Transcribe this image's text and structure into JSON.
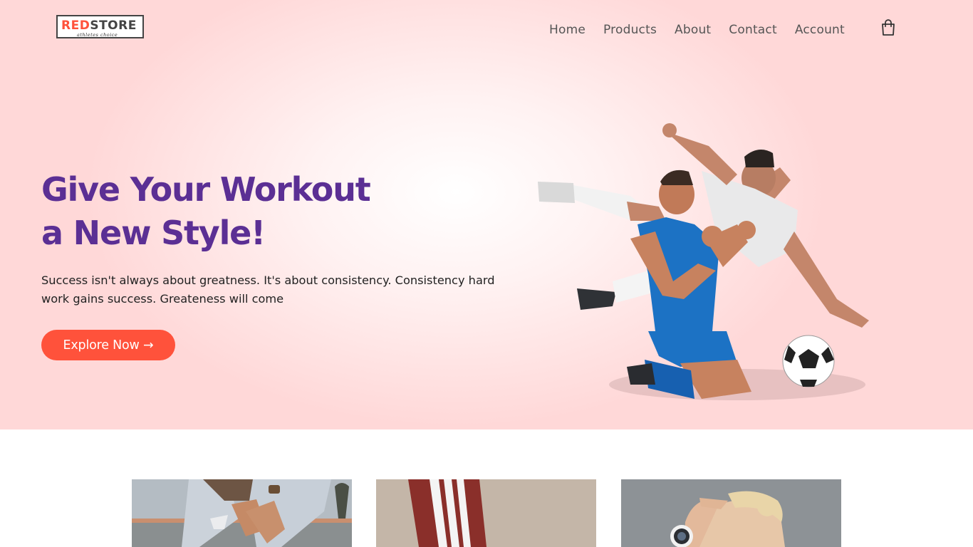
{
  "brand": {
    "name_red": "RED",
    "name_dark": "STORE",
    "tagline": "athletes choice",
    "accent_color": "#ff523b",
    "title_color": "#5b2f94"
  },
  "nav": {
    "items": [
      "Home",
      "Products",
      "About",
      "Contact",
      "Account"
    ],
    "cart_icon": "shopping-bag-icon"
  },
  "hero": {
    "title_line1": "Give Your Workout",
    "title_line2": "a New Style!",
    "description": "Success isn't always about greatness. It's about consistency. Consistency hard work gains success. Greateness will come",
    "cta_label": "Explore Now →",
    "image": "soccer-players-image"
  },
  "products": [
    {
      "image": "jeans-and-watch-product-image"
    },
    {
      "image": "track-pants-product-image"
    },
    {
      "image": "smartwatch-product-image"
    }
  ]
}
